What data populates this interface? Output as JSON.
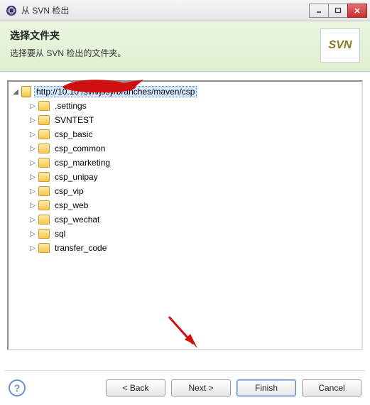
{
  "window": {
    "title": "从 SVN 检出",
    "min_label": "_",
    "max_label": "□",
    "close_label": "✕"
  },
  "header": {
    "title": "选择文件夹",
    "subtitle": "选择要从 SVN 检出的文件夹。",
    "svn_badge": "SVN"
  },
  "tree": {
    "root": {
      "label": "http://10.10           /svn/jssy/branches/maven/csp",
      "expanded": true,
      "selected": true
    },
    "children": [
      {
        "label": ".settings"
      },
      {
        "label": "SVNTEST"
      },
      {
        "label": "csp_basic"
      },
      {
        "label": "csp_common"
      },
      {
        "label": "csp_marketing"
      },
      {
        "label": "csp_unipay"
      },
      {
        "label": "csp_vip"
      },
      {
        "label": "csp_web"
      },
      {
        "label": "csp_wechat"
      },
      {
        "label": "sql"
      },
      {
        "label": "transfer_code"
      }
    ]
  },
  "footer": {
    "help": "?",
    "back": "< Back",
    "next": "Next >",
    "finish": "Finish",
    "cancel": "Cancel"
  },
  "icons": {
    "expanded": "◢",
    "collapsed": "▷"
  }
}
